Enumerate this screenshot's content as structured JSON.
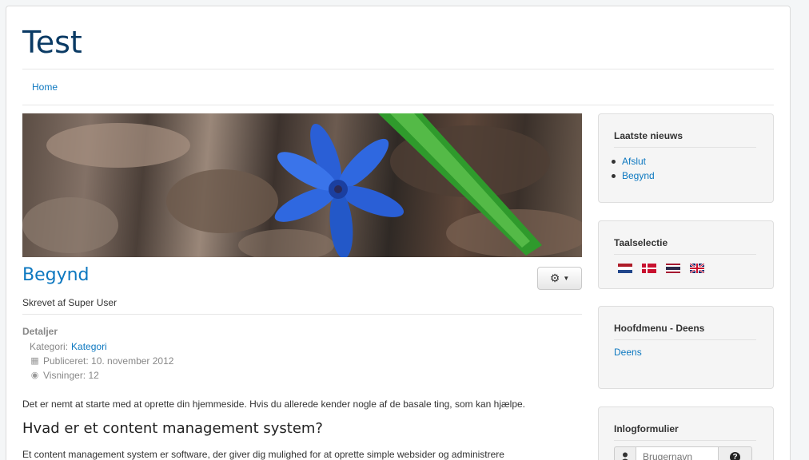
{
  "site": {
    "title": "Test"
  },
  "nav": {
    "home_label": "Home"
  },
  "article": {
    "title": "Begynd",
    "author": "Skrevet af Super User",
    "details_heading": "Detaljer",
    "category_label": "Kategori:",
    "category_link": "Kategori",
    "published": "Publiceret: 10. november 2012",
    "hits": "Visninger: 12",
    "intro": "Det er nemt at starte med at oprette din hjemmeside. Hvis du allerede kender nogle af de basale ting, som kan hjælpe.",
    "heading": "Hvad er et content management system?",
    "body": "Et content management system er software, der giver dig mulighed for at oprette simple websider og administrere"
  },
  "sidebar": {
    "news": {
      "title": "Laatste nieuws",
      "items": [
        "Afslut",
        "Begynd"
      ]
    },
    "language": {
      "title": "Taalselectie",
      "flags": [
        "nl-flag-icon",
        "dk-flag-icon",
        "th-flag-icon",
        "gb-flag-icon"
      ]
    },
    "mainmenu": {
      "title": "Hoofdmenu - Deens",
      "item": "Deens"
    },
    "login": {
      "title": "Inlogformulier",
      "username_placeholder": "Brugernavn"
    }
  },
  "colors": {
    "link": "#0d78c0",
    "site_title": "#0a3a64"
  }
}
